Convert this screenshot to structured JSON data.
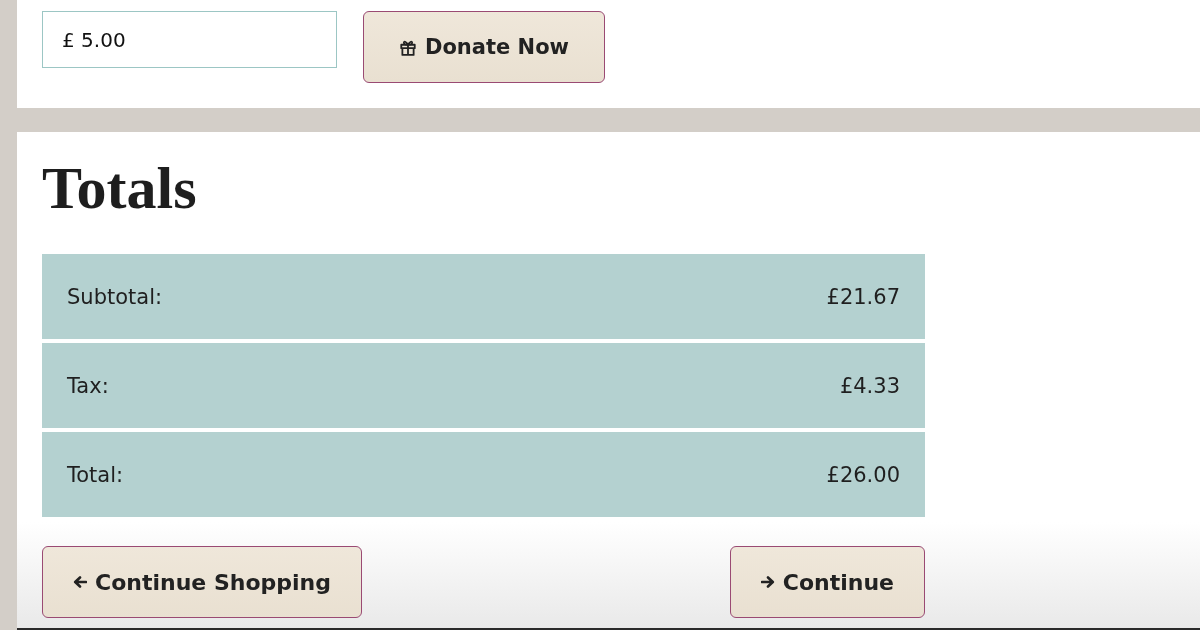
{
  "donation": {
    "amount": "£ 5.00",
    "button": "Donate Now"
  },
  "totals": {
    "title": "Totals",
    "rows": [
      {
        "label": "Subtotal:",
        "value": "£21.67"
      },
      {
        "label": "Tax:",
        "value": "£4.33"
      },
      {
        "label": "Total:",
        "value": "£26.00"
      }
    ]
  },
  "actions": [
    {
      "label": "Continue Shopping",
      "kind": "back"
    },
    {
      "label": "Continue",
      "kind": "forward"
    }
  ]
}
